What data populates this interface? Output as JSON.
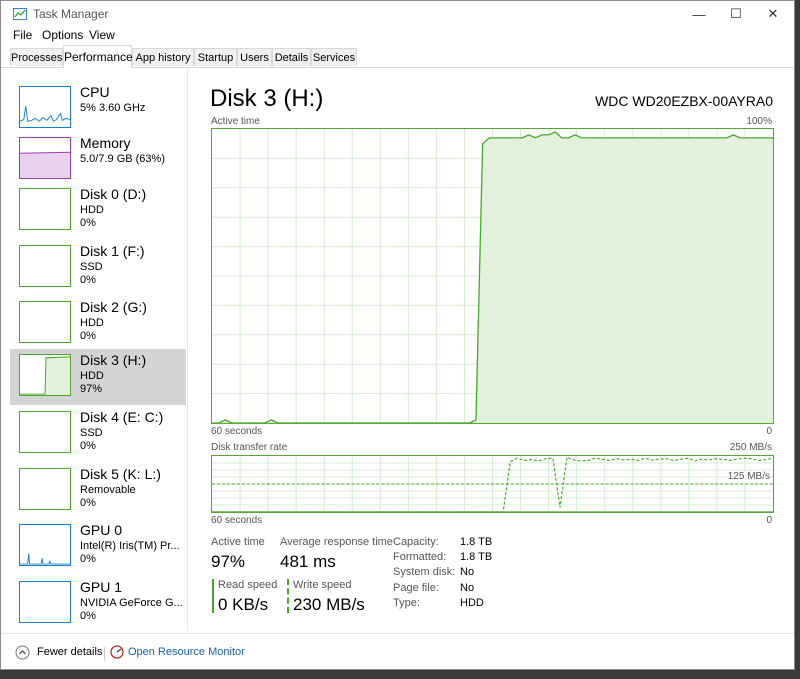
{
  "window": {
    "title": "Task Manager",
    "minimize": "—",
    "maximize": "☐",
    "close": "✕"
  },
  "menu": [
    "File",
    "Options",
    "View"
  ],
  "tabs": [
    "Processes",
    "Performance",
    "App history",
    "Startup",
    "Users",
    "Details",
    "Services"
  ],
  "sidebar": {
    "items": [
      {
        "name": "CPU",
        "line2": "5%  3.60 GHz",
        "line3": "",
        "color": "#1a7fc9"
      },
      {
        "name": "Memory",
        "line2": "5.0/7.9 GB (63%)",
        "line3": "",
        "color": "#a03ab8"
      },
      {
        "name": "Disk 0 (D:)",
        "line2": "HDD",
        "line3": "0%",
        "color": "#4aa52e"
      },
      {
        "name": "Disk 1 (F:)",
        "line2": "SSD",
        "line3": "0%",
        "color": "#4aa52e"
      },
      {
        "name": "Disk 2 (G:)",
        "line2": "HDD",
        "line3": "0%",
        "color": "#4aa52e"
      },
      {
        "name": "Disk 3 (H:)",
        "line2": "HDD",
        "line3": "97%",
        "color": "#4aa52e"
      },
      {
        "name": "Disk 4 (E: C:)",
        "line2": "SSD",
        "line3": "0%",
        "color": "#4aa52e"
      },
      {
        "name": "Disk 5 (K: L:)",
        "line2": "Removable",
        "line3": "0%",
        "color": "#4aa52e"
      },
      {
        "name": "GPU 0",
        "line2": "Intel(R) Iris(TM) Pr...",
        "line3": "0%",
        "color": "#1a7fc9"
      },
      {
        "name": "GPU 1",
        "line2": "NVIDIA GeForce G...",
        "line3": "0%",
        "color": "#1a7fc9"
      }
    ]
  },
  "main": {
    "title": "Disk 3 (H:)",
    "model": "WDC WD20EZBX-00AYRA0",
    "active_chart": {
      "label": "Active time",
      "max": "100%",
      "left": "60 seconds",
      "right": "0"
    },
    "transfer_chart": {
      "label": "Disk transfer rate",
      "max": "250 MB/s",
      "mid": "125 MB/s",
      "left": "60 seconds",
      "right": "0"
    },
    "stats": {
      "active_time_label": "Active time",
      "active_time": "97%",
      "avg_resp_label": "Average response time",
      "avg_resp": "481 ms",
      "read_label": "Read speed",
      "read": "0 KB/s",
      "write_label": "Write speed",
      "write": "230 MB/s"
    },
    "info": [
      {
        "k": "Capacity:",
        "v": "1.8 TB"
      },
      {
        "k": "Formatted:",
        "v": "1.8 TB"
      },
      {
        "k": "System disk:",
        "v": "No"
      },
      {
        "k": "Page file:",
        "v": "No"
      },
      {
        "k": "Type:",
        "v": "HDD"
      }
    ]
  },
  "footer": {
    "fewer": "Fewer details",
    "monitor": "Open Resource Monitor"
  },
  "chart_data": [
    {
      "type": "area",
      "title": "Active time",
      "ylim": [
        0,
        100
      ],
      "x_label_left": "60 seconds",
      "x_label_right": "0",
      "values": [
        0,
        0,
        1,
        0,
        0,
        0,
        0,
        0,
        0,
        1,
        0,
        0,
        0,
        0,
        0,
        0,
        0,
        0,
        0,
        0,
        0,
        0,
        0,
        0,
        0,
        0,
        0,
        0,
        0,
        0,
        0,
        0,
        0,
        0,
        0,
        0,
        0,
        0,
        0,
        0,
        1,
        95,
        97,
        97,
        97,
        97,
        97,
        97,
        98,
        97,
        98,
        98,
        99,
        97,
        97,
        98,
        97,
        97,
        97,
        97,
        97,
        97,
        97,
        97,
        97,
        97,
        97,
        97,
        97,
        97,
        97,
        97,
        97,
        97,
        97,
        97,
        97,
        97,
        97,
        98,
        97,
        97,
        97,
        97,
        97,
        97
      ]
    },
    {
      "type": "line",
      "title": "Disk transfer rate",
      "ylim": [
        0,
        250
      ],
      "units": "MB/s",
      "series": [
        {
          "values": [
            0,
            0,
            0,
            0,
            0,
            0,
            0,
            0,
            0,
            0,
            0,
            0,
            0,
            0,
            0,
            0,
            0,
            0,
            0,
            0,
            0,
            0,
            0,
            0,
            0,
            0,
            0,
            0,
            0,
            0,
            0,
            0,
            0,
            0,
            0,
            0,
            0,
            0,
            0,
            0,
            0,
            0,
            225,
            240,
            230,
            235,
            228,
            238,
            240,
            20,
            245,
            232,
            228,
            230,
            240,
            235,
            230,
            238,
            233,
            235,
            230,
            240,
            232,
            236,
            238,
            230,
            235,
            240,
            228,
            236,
            232,
            238,
            235,
            230,
            236,
            240,
            238,
            230,
            234,
            240
          ]
        },
        {
          "values": [
            0,
            0,
            0,
            0,
            0,
            0,
            0,
            0,
            0,
            0,
            0,
            0,
            0,
            0,
            0,
            0,
            0,
            0,
            0,
            0,
            0,
            0,
            0,
            0,
            0,
            0,
            0,
            0,
            0,
            0,
            0,
            0,
            0,
            0,
            0,
            0,
            0,
            0,
            0,
            0,
            0,
            0,
            0,
            0,
            0,
            0,
            0,
            0,
            0,
            0,
            0,
            0,
            0,
            0,
            0,
            0,
            0,
            0,
            0,
            0,
            0,
            0,
            0,
            0,
            0,
            0,
            0,
            0,
            0,
            0,
            0,
            0,
            0,
            0,
            0,
            0,
            0,
            0,
            0,
            0
          ]
        }
      ]
    }
  ]
}
